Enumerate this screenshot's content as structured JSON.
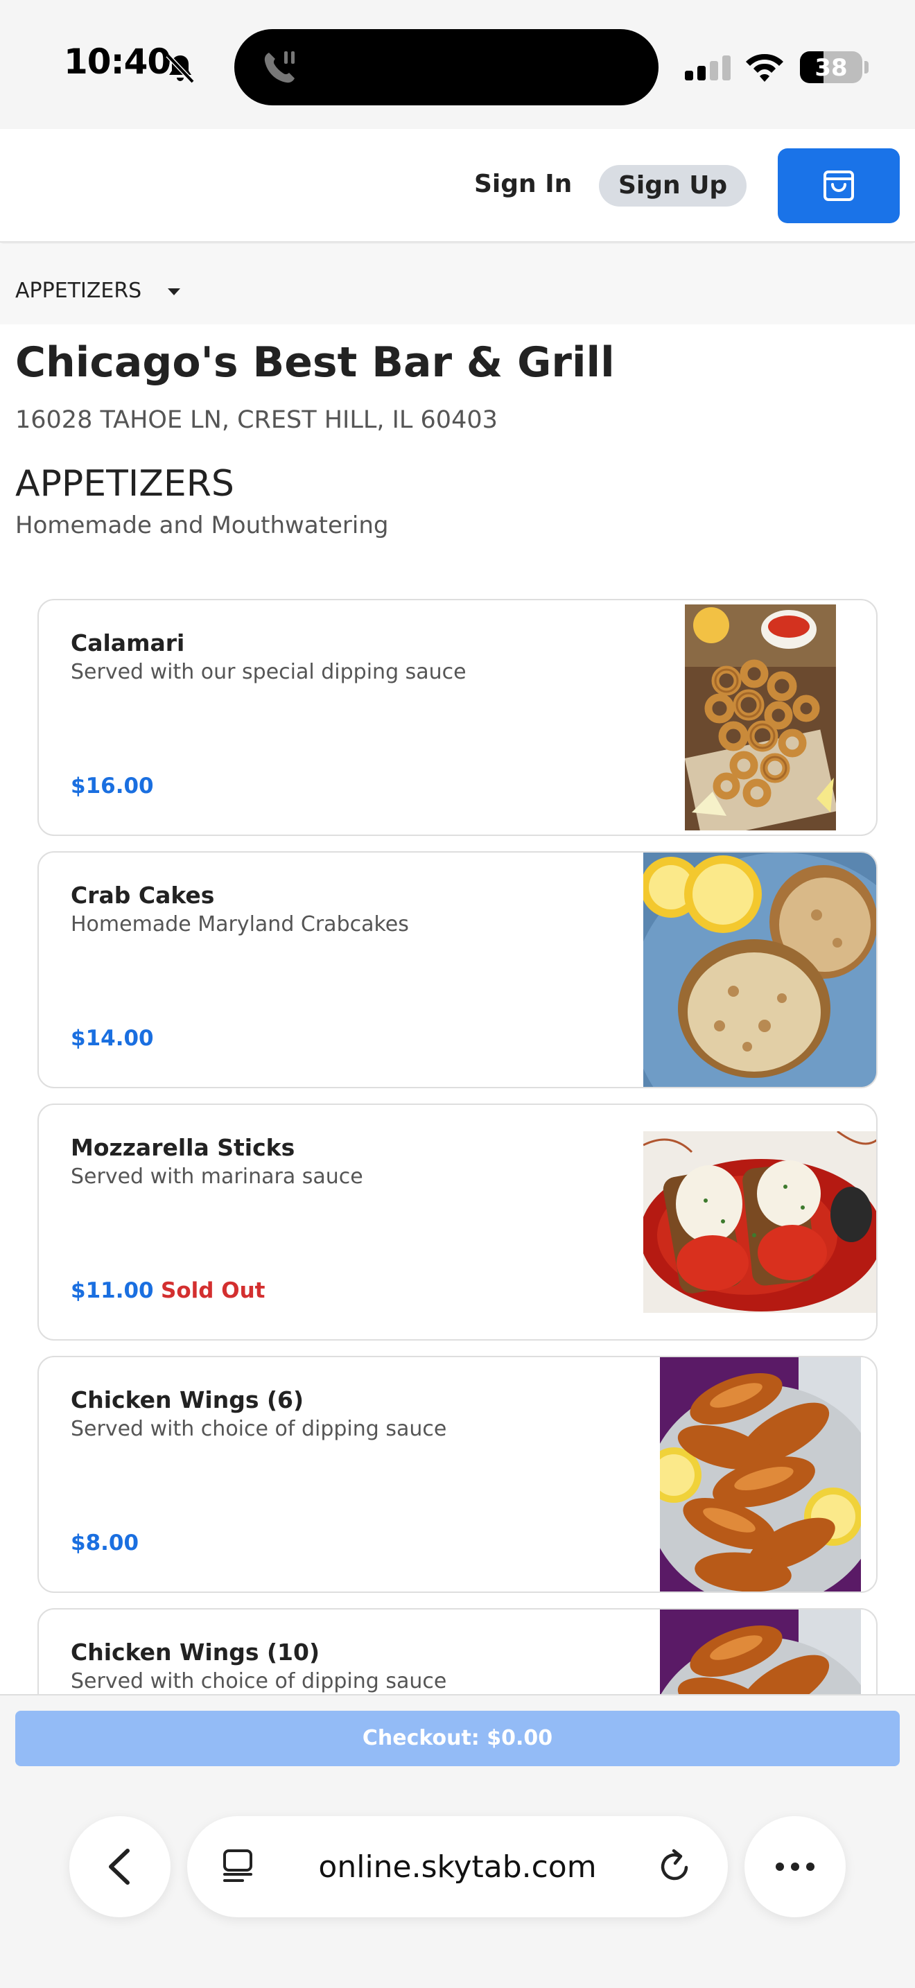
{
  "status_bar": {
    "time": "10:40",
    "battery": "38",
    "battery_level": 0.38
  },
  "nav": {
    "sign_in": "Sign In",
    "sign_up": "Sign Up",
    "cart_icon": "shopping-bag-icon"
  },
  "category_select": {
    "selected": "APPETIZERS"
  },
  "restaurant": {
    "name": "Chicago's Best Bar & Grill",
    "address": "16028 TAHOE LN, CREST HILL, IL 60403"
  },
  "section": {
    "title": "APPETIZERS",
    "subtitle": "Homemade and Mouthwatering"
  },
  "menu_items": [
    {
      "name": "Calamari",
      "description": "Served with our special dipping sauce",
      "price": "$16.00",
      "status": ""
    },
    {
      "name": "Crab Cakes",
      "description": "Homemade Maryland Crabcakes",
      "price": "$14.00",
      "status": ""
    },
    {
      "name": "Mozzarella Sticks",
      "description": "Served with marinara sauce",
      "price": "$11.00",
      "status": "Sold Out"
    },
    {
      "name": "Chicken Wings (6)",
      "description": "Served with choice of dipping sauce",
      "price": "$8.00",
      "status": ""
    },
    {
      "name": "Chicken Wings (10)",
      "description": "Served with choice of dipping sauce",
      "price": "",
      "status": ""
    }
  ],
  "checkout": {
    "label": "Checkout: $0.00"
  },
  "browser": {
    "url": "online.skytab.com"
  },
  "colors": {
    "accent": "#1a73e8",
    "price": "#1a6fe0",
    "sold_out": "#d32f2f",
    "checkout_disabled": "#93bbf6"
  }
}
